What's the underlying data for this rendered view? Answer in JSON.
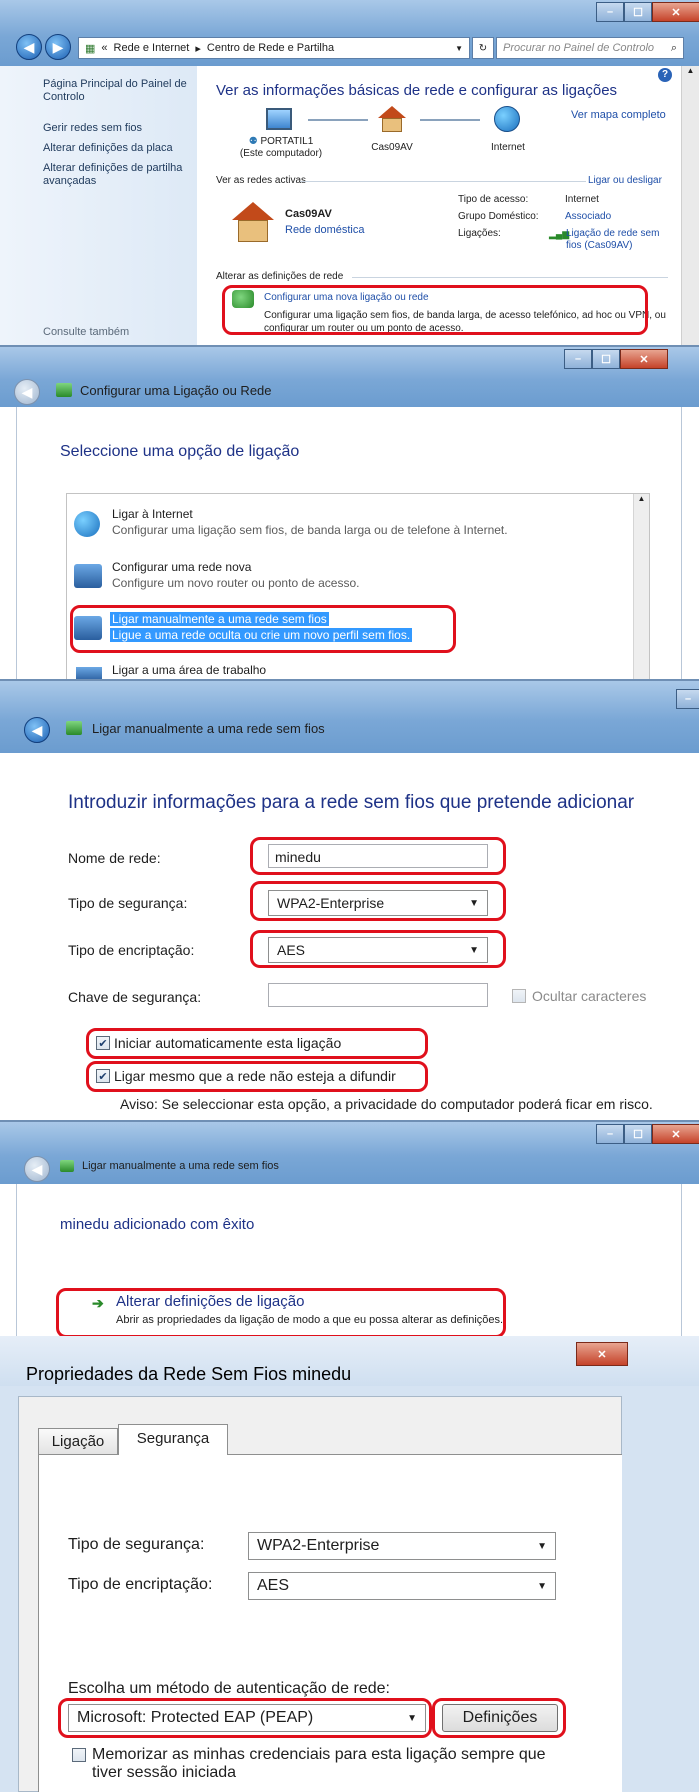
{
  "p1": {
    "breadcrumb": [
      "Rede e Internet",
      "Centro de Rede e Partilha"
    ],
    "search_placeholder": "Procurar no Painel de Controlo",
    "sidebar": [
      "Página Principal do Painel de Controlo",
      "Gerir redes sem fios",
      "Alterar definições da placa",
      "Alterar definições de partilha avançadas"
    ],
    "see_also": "Consulte também",
    "title": "Ver as informações básicas de rede e configurar as ligações",
    "map_link": "Ver mapa completo",
    "nodes": [
      {
        "name": "PORTATIL1",
        "sub": "(Este computador)"
      },
      {
        "name": "Cas09AV",
        "sub": ""
      },
      {
        "name": "Internet",
        "sub": ""
      }
    ],
    "active_header": "Ver as redes activas",
    "connect_link": "Ligar ou desligar",
    "network_name": "Cas09AV",
    "network_type": "Rede doméstica",
    "access_label": "Tipo de acesso:",
    "access_value": "Internet",
    "group_label": "Grupo Doméstico:",
    "group_value": "Associado",
    "conn_label": "Ligações:",
    "conn_value": "Ligação de rede sem fios (Cas09AV)",
    "change_header": "Alterar as definições de rede",
    "new_conn_link": "Configurar uma nova ligação ou rede",
    "new_conn_desc": "Configurar uma ligação sem fios, de banda larga, de acesso telefónico, ad hoc ou VPN, ou configurar um router ou um ponto de acesso."
  },
  "p2": {
    "window_title": "Configurar uma Ligação ou Rede",
    "heading": "Seleccione uma opção de ligação",
    "options": [
      {
        "title": "Ligar à Internet",
        "desc": "Configurar uma ligação sem fios, de banda larga ou de telefone à Internet."
      },
      {
        "title": "Configurar uma rede nova",
        "desc": "Configure um novo router ou ponto de acesso."
      },
      {
        "title": "Ligar manualmente a uma rede sem fios",
        "desc": "Ligue a uma rede oculta ou crie um novo perfil sem fios."
      },
      {
        "title": "Ligar a uma área de trabalho",
        "desc": ""
      }
    ]
  },
  "p3": {
    "window_title": "Ligar manualmente a uma rede sem fios",
    "heading": "Introduzir informações para a rede sem fios que pretende adicionar",
    "name_label": "Nome de rede:",
    "name_value": "minedu",
    "security_label": "Tipo de segurança:",
    "security_value": "WPA2-Enterprise",
    "encryption_label": "Tipo de encriptação:",
    "encryption_value": "AES",
    "key_label": "Chave de segurança:",
    "hide_chars": "Ocultar caracteres",
    "auto_start": "Iniciar automaticamente esta ligação",
    "connect_hidden": "Ligar mesmo que a rede não esteja a difundir",
    "warning": "Aviso: Se seleccionar esta opção, a privacidade do computador poderá ficar em risco."
  },
  "p4": {
    "window_title": "Ligar manualmente a uma rede sem fios",
    "success": "minedu adicionado com êxito",
    "change_title": "Alterar definições de ligação",
    "change_desc": "Abrir as propriedades da ligação de modo a que eu possa alterar as definições."
  },
  "p5": {
    "window_title": "Propriedades da Rede Sem Fios minedu",
    "tabs": [
      "Ligação",
      "Segurança"
    ],
    "security_label": "Tipo de segurança:",
    "security_value": "WPA2-Enterprise",
    "encryption_label": "Tipo de encriptação:",
    "encryption_value": "AES",
    "auth_label": "Escolha um método de autenticação de rede:",
    "auth_value": "Microsoft: Protected EAP (PEAP)",
    "settings_button": "Definições",
    "remember": "Memorizar as minhas credenciais para esta ligação sempre que tiver sessão iniciada"
  }
}
